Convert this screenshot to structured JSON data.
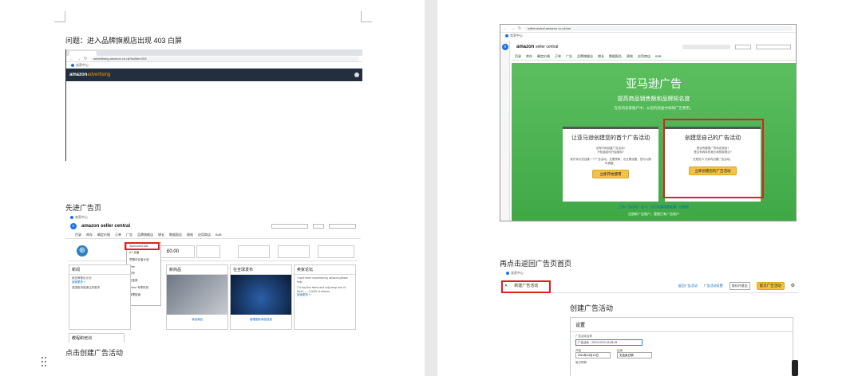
{
  "left_page": {
    "caption1": "问题：进入品牌旗舰店出现 403 白屏",
    "caption2": "先进广告页",
    "caption3": "点击创建广告活动",
    "shot1": {
      "url": "advertising.amazon.co.uk/builder/403",
      "bookmark": "卖家中心",
      "brand_prefix": "amazon",
      "brand_suffix": "advertising"
    },
    "shot2": {
      "bookmark": "卖家中心",
      "logo": "amazon seller central",
      "logo_sub": "Europe",
      "nav": [
        "目录",
        "库存",
        "确定价格",
        "订单",
        "广告",
        "品牌旗舰店",
        "增长",
        "数据报告",
        "绩效",
        "应用商店",
        "B2B"
      ],
      "menu_items": [
        "Sponsored Ads",
        "A+ 页面",
        "早期评论者计划",
        "Vine",
        "秒杀",
        "优惠券",
        "Prime 专享折扣",
        "管理促销"
      ],
      "cards": [
        {
          "title": "新闻",
          "items": [
            "新品牌推出计划",
            "英国取消普通注册要求"
          ],
          "more": "阅读更多 »"
        },
        {
          "title": "新商品",
          "items": [
            "添加商品"
          ],
          "more": "添加商品"
        },
        {
          "title": "在全球发布",
          "items": [
            "管理国际商品信息"
          ],
          "more": "管理国际商品信息"
        },
        {
          "title": "卖家论坛",
          "items": [
            "I have been scammed by amazon please help",
            "\"I'd buy five items and only keep one of them\" — 1,0000 of returns"
          ],
          "more": "阅读更多 »"
        }
      ],
      "training": "教程和培训"
    }
  },
  "right_page": {
    "caption1": "再点击返回广告页首页",
    "shot3": {
      "url": "sellercentral.amazon.co.uk/cm",
      "bookmark": "卖家中心",
      "nav": [
        "目录",
        "库存",
        "确定价格",
        "订单",
        "广告",
        "品牌旗舰店",
        "增长",
        "数据报告",
        "绩效",
        "应用商店",
        "B2B"
      ],
      "hero_title": "亚马逊广告",
      "hero_subtitle": "提高商品销售额和品牌知名度",
      "hero_desc": "在您的卖家账户中，从您的资金中扣除广告费用。",
      "card_left": {
        "title": "让亚马逊创建您的首个广告活动",
        "q1": "没有时间创建广告活动?",
        "q2": "不知道如何开始使用?",
        "body": "我们将为您创建一个广告活动，无需预算，也无需设置，您可以随时调整。",
        "button": "立即开始使用"
      },
      "card_right": {
        "title": "创建您自己的广告活动",
        "q1": "是否有要推广的特定商品?",
        "q2": "是否有具体的竞价和预算想法?",
        "body": "在短短 5 分钟内创建广告活动。",
        "button": "立即创建您的广告活动"
      },
      "footer1": "已有广告活动？进入广告活动管理器查看广告数据",
      "footer2": "注册新广告账户，管理已有广告账户"
    },
    "shot4": {
      "bookmark": "卖家中心",
      "tab_title": "新建广告活动",
      "top_links": [
        "返回广告活动",
        "广告活动设置",
        "保存并退出"
      ],
      "top_button": "提交广告活动",
      "page_title": "创建广告活动",
      "section": "设置",
      "field1_label": "广告活动名称",
      "field1_value": "广告活动 - 2021/12/13 16:08:33",
      "field2_label": "开始",
      "field2_value": "2021年12月13日",
      "field3_label": "结束",
      "field3_value": "无结束日期",
      "field4_label": "每日预算"
    }
  },
  "colors": {
    "accent_red": "#e02020",
    "amazon_yellow": "#f3c245",
    "ad_green": "#4caf50",
    "link_blue": "#0066c0"
  }
}
